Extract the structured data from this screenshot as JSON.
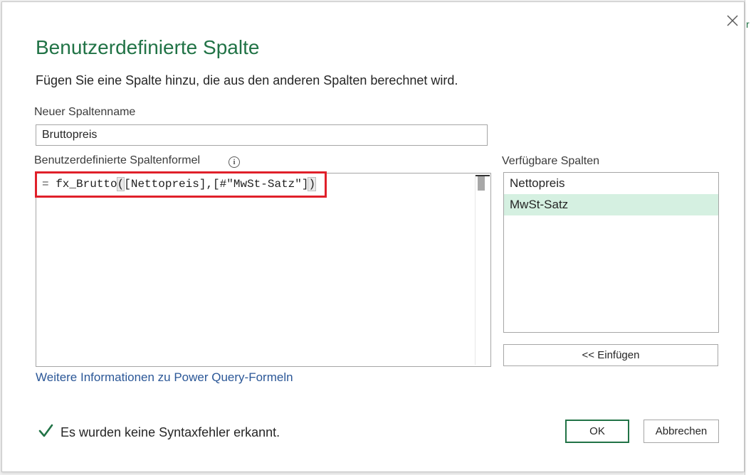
{
  "dialog": {
    "title": "Benutzerdefinierte Spalte",
    "subtitle": "Fügen Sie eine Spalte hinzu, die aus den anderen Spalten berechnet wird.",
    "close_icon": "close-icon"
  },
  "column_name": {
    "label": "Neuer Spaltenname",
    "value": "Bruttopreis"
  },
  "formula": {
    "label": "Benutzerdefinierte Spaltenformel",
    "info_icon": "info-icon",
    "info_glyph": "i",
    "prefix": "= ",
    "function_name": "fx_Brutto",
    "open_paren": "(",
    "arguments": "[Nettopreis],[#\"MwSt-Satz\"]",
    "close_paren": ")",
    "highlight_color": "#e0202a"
  },
  "available_columns": {
    "label": "Verfügbare Spalten",
    "items": [
      "Nettopreis",
      "MwSt-Satz"
    ],
    "selected": "MwSt-Satz"
  },
  "insert_button": {
    "label": "<< Einfügen"
  },
  "help_link": {
    "text": "Weitere Informationen zu Power Query-Formeln"
  },
  "status": {
    "icon": "checkmark-icon",
    "text": "Es wurden keine Syntaxfehler erkannt."
  },
  "buttons": {
    "ok": "OK",
    "cancel": "Abbrechen"
  },
  "colors": {
    "accent": "#217346",
    "selection": "#d5f0e1",
    "link": "#2b5797"
  }
}
